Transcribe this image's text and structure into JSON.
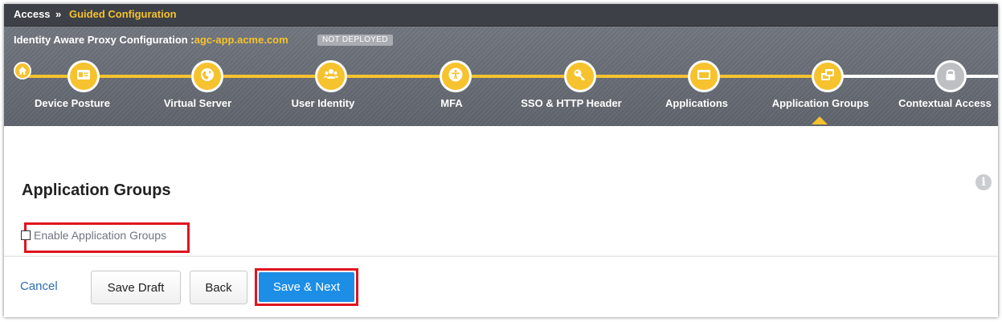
{
  "breadcrumb": {
    "root": "Access",
    "separator": "»",
    "current": "Guided Configuration"
  },
  "config": {
    "label": "Identity Aware Proxy Configuration :",
    "host": "agc-app.acme.com",
    "status_badge": "NOT DEPLOYED"
  },
  "home_icon": "home-icon",
  "steps": [
    {
      "label": "Device Posture",
      "icon": "id-card-icon",
      "state": "complete"
    },
    {
      "label": "Virtual Server",
      "icon": "globe-icon",
      "state": "complete"
    },
    {
      "label": "User Identity",
      "icon": "users-icon",
      "state": "complete"
    },
    {
      "label": "MFA",
      "icon": "accessibility-icon",
      "state": "complete"
    },
    {
      "label": "SSO & HTTP Header",
      "icon": "key-icon",
      "state": "complete"
    },
    {
      "label": "Applications",
      "icon": "window-icon",
      "state": "complete"
    },
    {
      "label": "Application Groups",
      "icon": "windows-stack-icon",
      "state": "current"
    },
    {
      "label": "Contextual Access",
      "icon": "lock-icon",
      "state": "locked"
    }
  ],
  "colors": {
    "accent": "#f6c22d",
    "primary_button": "#1d8ee6",
    "highlight": "#e0141e",
    "link": "#2b6cb3"
  },
  "section": {
    "title": "Application Groups",
    "checkbox_label": "Enable Application Groups",
    "checkbox_checked": false
  },
  "footer": {
    "cancel": "Cancel",
    "save_draft": "Save Draft",
    "back": "Back",
    "save_next": "Save & Next"
  }
}
